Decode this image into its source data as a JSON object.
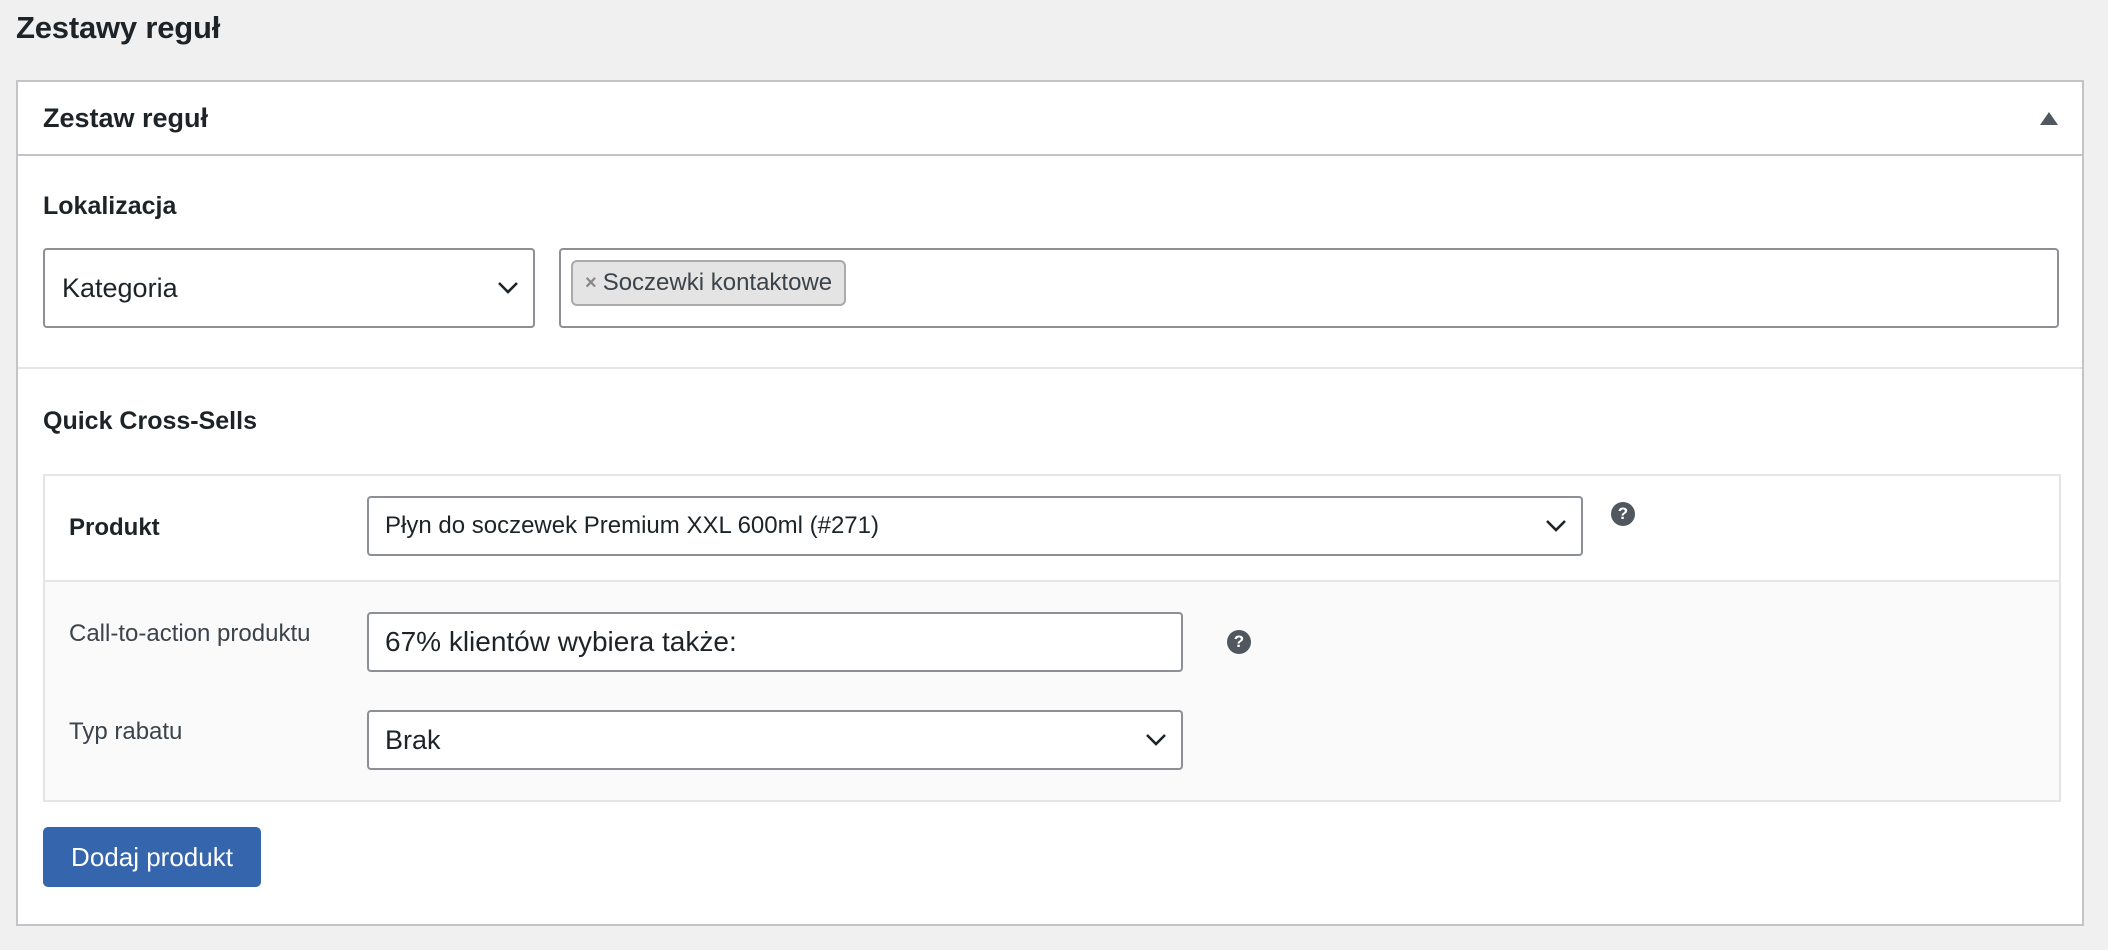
{
  "page": {
    "title": "Zestawy reguł"
  },
  "postbox": {
    "title": "Zestaw reguł",
    "toggle_icon": "triangle-up-icon"
  },
  "location": {
    "label": "Lokalizacja",
    "select_value": "Kategoria",
    "tags": [
      {
        "remove_symbol": "×",
        "label": "Soczewki kontaktowe"
      }
    ]
  },
  "cross_sells": {
    "label": "Quick Cross-Sells",
    "product": {
      "label": "Produkt",
      "select_value": "Płyn do soczewek Premium XXL 600ml (#271)",
      "help": "?"
    },
    "cta": {
      "label": "Call-to-action produktu",
      "value": "67% klientów wybiera także:",
      "help": "?"
    },
    "discount": {
      "label": "Typ rabatu",
      "select_value": "Brak"
    },
    "add_button": "Dodaj produkt"
  },
  "colors": {
    "accent": "#3566ad",
    "background": "#f0f0f1",
    "border": "#8c8f94"
  }
}
